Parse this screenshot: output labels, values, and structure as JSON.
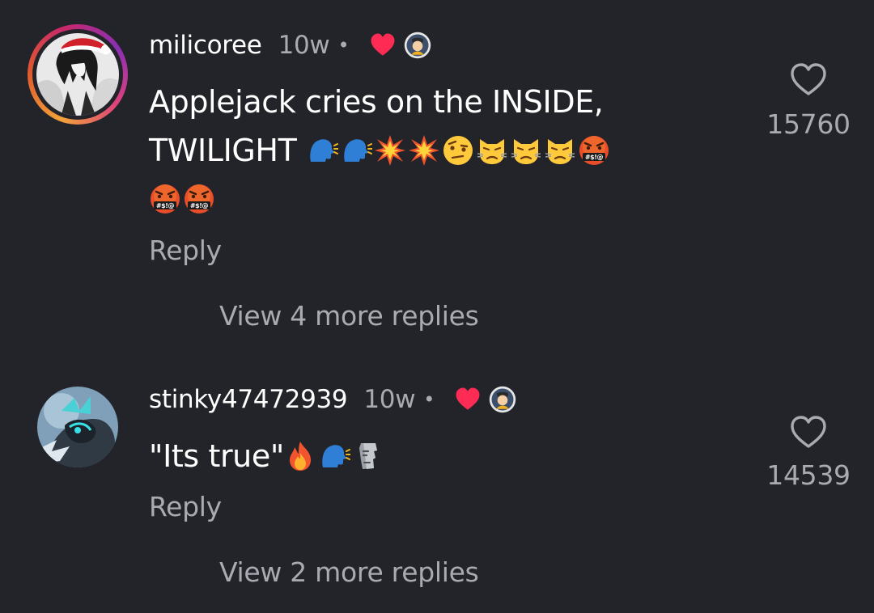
{
  "comments": [
    {
      "username": "milicoree",
      "time": "10w",
      "separator": "•",
      "text_line_1": "Applejack cries on the INSIDE,",
      "text_line_2": "TWILIGHT",
      "emojis": [
        "speaking-head",
        "speaking-head",
        "collision",
        "collision",
        "raised-eyebrow",
        "pouting-cat",
        "pouting-cat",
        "pouting-cat",
        "cursing-face",
        "cursing-face",
        "cursing-face"
      ],
      "reply_label": "Reply",
      "view_more_label": "View 4 more replies",
      "likes": "15760",
      "creator_liked": true
    },
    {
      "username": "stinky47472939",
      "time": "10w",
      "separator": "•",
      "text": "\"Its true\"",
      "emojis": [
        "fire",
        "speaking-head",
        "moai"
      ],
      "reply_label": "Reply",
      "view_more_label": "View 2 more replies",
      "likes": "14539",
      "creator_liked": true
    }
  ],
  "colors": {
    "background": "#232429",
    "primary_text": "#ffffff",
    "secondary_text": "#a9abb2",
    "heart_red": "#fe2c55"
  }
}
